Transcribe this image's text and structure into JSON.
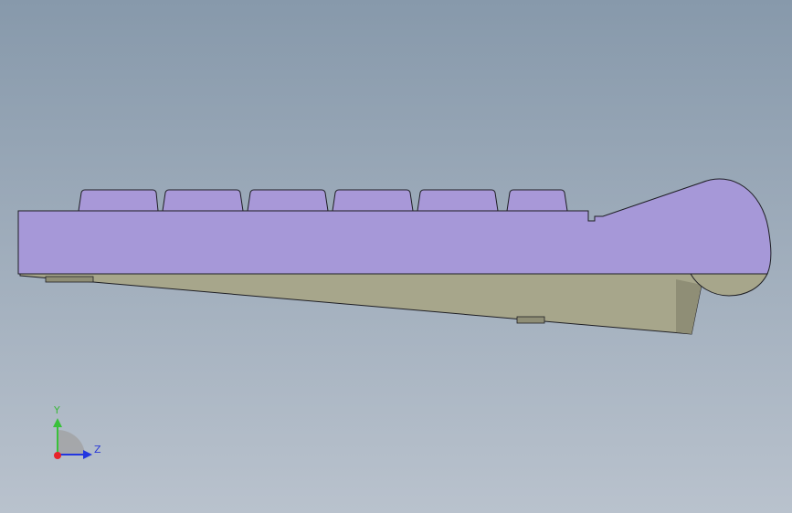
{
  "colors": {
    "background_top": "#8799ab",
    "background_bottom": "#b9c2cd",
    "key_fill": "#a898d8",
    "body_fill": "#a698d8",
    "body_outline": "#1e1e24",
    "base_fill": "#a7a68b",
    "base_shadow": "#8f8e76",
    "axis_x": "#e8242a",
    "axis_y": "#39c13a",
    "axis_z": "#2336e0",
    "axis_label_y": "#3ab83a",
    "axis_label_z": "#2b3ad6"
  },
  "model": {
    "view": "side-view",
    "part": "keyboard",
    "key_count": 6
  },
  "triad": {
    "y_label": "Y",
    "z_label": "Z"
  }
}
